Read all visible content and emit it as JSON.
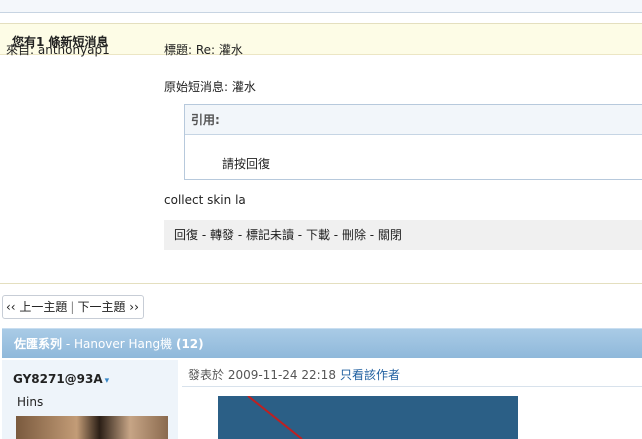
{
  "pm": {
    "header_title": "您有1 條新短消息",
    "from_label": "來自: anthonyap1",
    "subject_label": "標題: Re: 灌水",
    "original_label": "原始短消息: 灌水",
    "quote_header": "引用:",
    "quote_text": "請按回復",
    "message_text": "collect skin la",
    "actions": [
      "回復",
      "轉發",
      "標記未讀",
      "下載",
      "刪除",
      "關閉"
    ],
    "action_separator": " - "
  },
  "thread_nav": {
    "prev_label": "‹‹ 上一主題",
    "next_label": "下一主題 ››"
  },
  "thread": {
    "title_bold": "佐匯系列",
    "title_rest": " - Hanover Hang機 ",
    "reply_count": "(12)"
  },
  "post": {
    "author": "GY8271@93A",
    "author_arrow": "▾",
    "user_title": "Hins",
    "posted_prefix": "發表於 2009-11-24 22:18",
    "only_author_link": "只看該作者"
  },
  "colors": {
    "pm_header_bg": "#fdfce6",
    "thread_bar": "#9cc2e1",
    "link_blue": "#1f5fa0",
    "post_sidebar": "#eef4fa",
    "image_bg": "#2b5f86",
    "image_line": "#c02020"
  }
}
